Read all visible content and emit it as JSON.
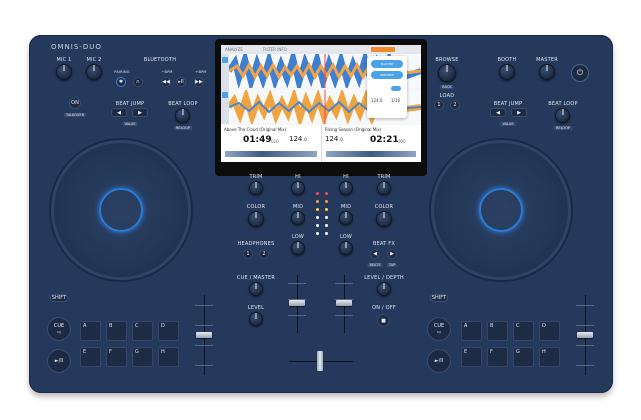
{
  "brand": "OMNIS-DUO",
  "left": {
    "mic1": "MIC 1",
    "mic2": "MIC 2",
    "bluetooth": "BLUETOOTH",
    "pairing": "PAIRING",
    "on": "ON",
    "talkover": "TALKOVER",
    "beat_jump": "BEAT JUMP",
    "value": "VALUE",
    "beat_loop": "BEAT LOOP",
    "reloop": "RELOOP",
    "shift": "SHIFT",
    "cue": "CUE",
    "cue_sub": "DJ",
    "play": "►/II",
    "pads": [
      "A",
      "B",
      "C",
      "D",
      "E",
      "F",
      "G",
      "H"
    ],
    "bt_minus": "−BPM",
    "bt_plus": "+BPM"
  },
  "right": {
    "browse": "BROWSE",
    "back": "BACK",
    "load": "LOAD",
    "load_1": "1",
    "load_2": "2",
    "booth": "BOOTH",
    "master": "MASTER",
    "beat_jump": "BEAT JUMP",
    "value": "VALUE",
    "beat_loop": "BEAT LOOP",
    "reloop": "RELOOP",
    "shift": "SHIFT",
    "cue": "CUE",
    "cue_sub": "DJ",
    "play": "►/II",
    "pads": [
      "A",
      "B",
      "C",
      "D",
      "E",
      "F",
      "G",
      "H"
    ]
  },
  "mixer": {
    "trim": "TRIM",
    "hi": "HI",
    "mid": "MID",
    "low": "LOW",
    "color": "COLOR",
    "headphones": "HEADPHONES",
    "hp1": "1",
    "hp2": "2",
    "beat_fx": "BEAT FX",
    "fx_beat": "BEATS",
    "fx_tap": "TAP",
    "cue_master": "CUE / MASTER",
    "level": "LEVEL",
    "level_depth": "LEVEL / DEPTH",
    "on_off": "ON / OFF"
  },
  "screen": {
    "menu": "ANALYZE",
    "sort": "FILTER INFO",
    "left_track": "Above The Cloud (Original Mix)",
    "left_time": "01:49",
    "left_time_sub": "020",
    "left_bpm": "124",
    "left_bpm_dec": ".0",
    "right_track": "Rising Season (Original Mix)",
    "right_time": "02:21",
    "right_time_sub": "000",
    "right_bpm": "124",
    "right_bpm_dec": ".0",
    "popup_a": "PLAY/MP",
    "popup_b": "PREVIEW",
    "popup_bpm": "124.0",
    "popup_beat": "1/16",
    "key": "Cm",
    "side_a": "MASTER"
  }
}
